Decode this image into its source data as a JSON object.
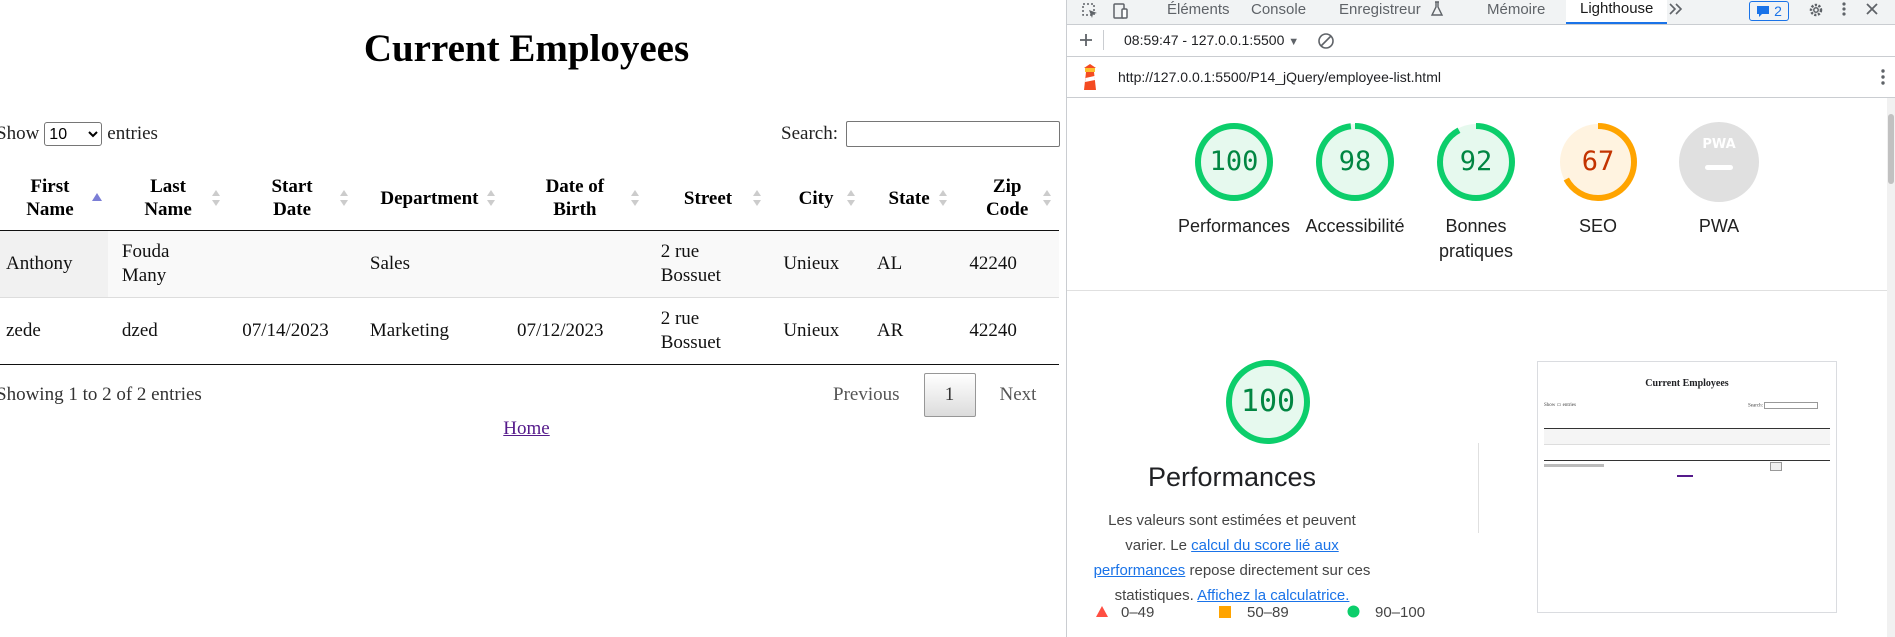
{
  "page": {
    "title": "Current Employees",
    "show_label": "Show",
    "entries_label": "entries",
    "length_selected": "10",
    "search_label": "Search:",
    "search_value": "",
    "columns": [
      {
        "label_line1": "First",
        "label_line2": "Name",
        "sort": "asc"
      },
      {
        "label_line1": "Last",
        "label_line2": "Name",
        "sort": "both"
      },
      {
        "label_line1": "Start",
        "label_line2": "Date",
        "sort": "both"
      },
      {
        "label_line1": "Department",
        "label_line2": "",
        "sort": "both"
      },
      {
        "label_line1": "Date of",
        "label_line2": "Birth",
        "sort": "both"
      },
      {
        "label_line1": "Street",
        "label_line2": "",
        "sort": "both"
      },
      {
        "label_line1": "City",
        "label_line2": "",
        "sort": "both"
      },
      {
        "label_line1": "State",
        "label_line2": "",
        "sort": "both"
      },
      {
        "label_line1": "Zip",
        "label_line2": "Code",
        "sort": "both"
      }
    ],
    "rows": [
      {
        "first": "Anthony",
        "last_1": "Fouda",
        "last_2": "Many",
        "start": "",
        "department": "Sales",
        "dob": "",
        "street_1": "2 rue",
        "street_2": "Bossuet",
        "city": "Unieux",
        "state": "AL",
        "zip": "42240"
      },
      {
        "first": "zede",
        "last_1": "dzed",
        "last_2": "",
        "start": "07/14/2023",
        "department": "Marketing",
        "dob": "07/12/2023",
        "street_1": "2 rue",
        "street_2": "Bossuet",
        "city": "Unieux",
        "state": "AR",
        "zip": "42240"
      }
    ],
    "info": "Showing 1 to 2 of 2 entries",
    "pager": {
      "previous": "Previous",
      "current": "1",
      "next": "Next"
    },
    "home_link": "Home"
  },
  "devtools": {
    "tabs": [
      "Éléments",
      "Console",
      "Enregistreur",
      "Mémoire",
      "Lighthouse"
    ],
    "issues_count": "2",
    "report_time": "08:59:47 - 127.0.0.1:5500",
    "url": "http://127.0.0.1:5500/P14_jQuery/employee-list.html",
    "gauges": [
      {
        "score": "100",
        "value": 1.0,
        "label": "Performances",
        "color": "#0cce6b",
        "text_color": "#018642",
        "bg": "#e6f9ee"
      },
      {
        "score": "98",
        "value": 0.98,
        "label": "Accessibilité",
        "color": "#0cce6b",
        "text_color": "#018642",
        "bg": "#e6f9ee"
      },
      {
        "score": "92",
        "value": 0.92,
        "label": "Bonnes pratiques",
        "color": "#0cce6b",
        "text_color": "#018642",
        "bg": "#e6f9ee"
      },
      {
        "score": "67",
        "value": 0.67,
        "label": "SEO",
        "color": "#ffa400",
        "text_color": "#c33300",
        "bg": "#fff3e0"
      },
      {
        "score": "",
        "value": 0,
        "label": "PWA",
        "color": "#dadada",
        "text_color": "#fff",
        "bg": "#e0e0e0"
      }
    ],
    "pwa_badge": "PWA",
    "perf": {
      "score": "100",
      "title": "Performances",
      "desc_1": "Les valeurs sont estimées et peuvent varier. Le ",
      "desc_link_1": "calcul du score lié aux performances",
      "desc_2": " repose directement sur ces statistiques. ",
      "desc_link_2": "Affichez la calculatrice."
    },
    "legend": {
      "red": "0–49",
      "orange": "50–89",
      "green": "90–100"
    },
    "colors": {
      "green": "#0cce6b",
      "orange": "#ffa400",
      "red": "#ff4e42",
      "accent": "#1a73e8"
    }
  }
}
